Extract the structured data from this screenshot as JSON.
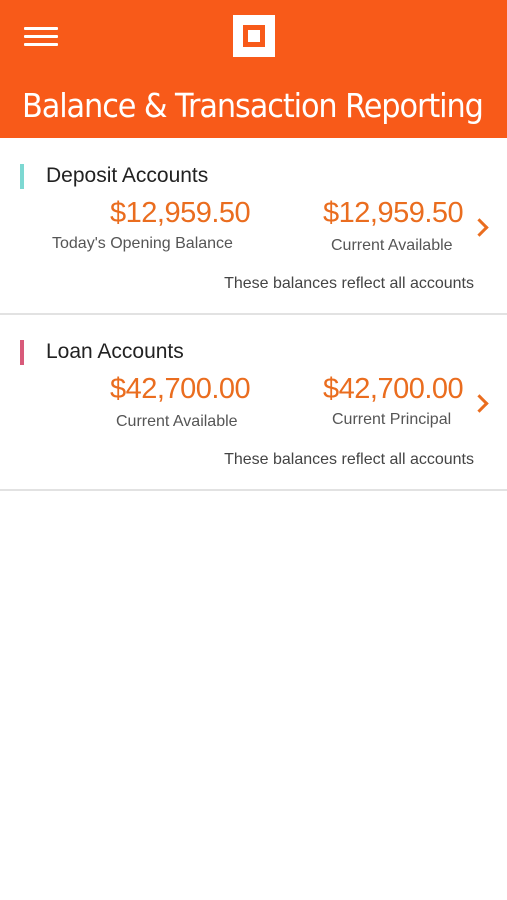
{
  "colors": {
    "brand": "#f85a19",
    "amount": "#ea6d1f",
    "deposit_accent": "#7dd8d2",
    "loan_accent": "#d85a7a"
  },
  "header": {
    "menu_icon": "hamburger-menu-icon",
    "logo_icon": "square-logo-icon",
    "title": "Balance & Transaction Reporting"
  },
  "deposit": {
    "title": "Deposit Accounts",
    "left_amount": "$12,959.50",
    "left_label": "Today's Opening Balance",
    "right_amount": "$12,959.50",
    "right_label": "Current Available",
    "footnote": "These balances reflect all accounts",
    "chevron_icon": "chevron-right-icon"
  },
  "loan": {
    "title": "Loan Accounts",
    "left_amount": "$42,700.00",
    "left_label": "Current Available",
    "right_amount": "$42,700.00",
    "right_label": "Current Principal",
    "footnote": "These balances reflect all accounts",
    "chevron_icon": "chevron-right-icon"
  }
}
